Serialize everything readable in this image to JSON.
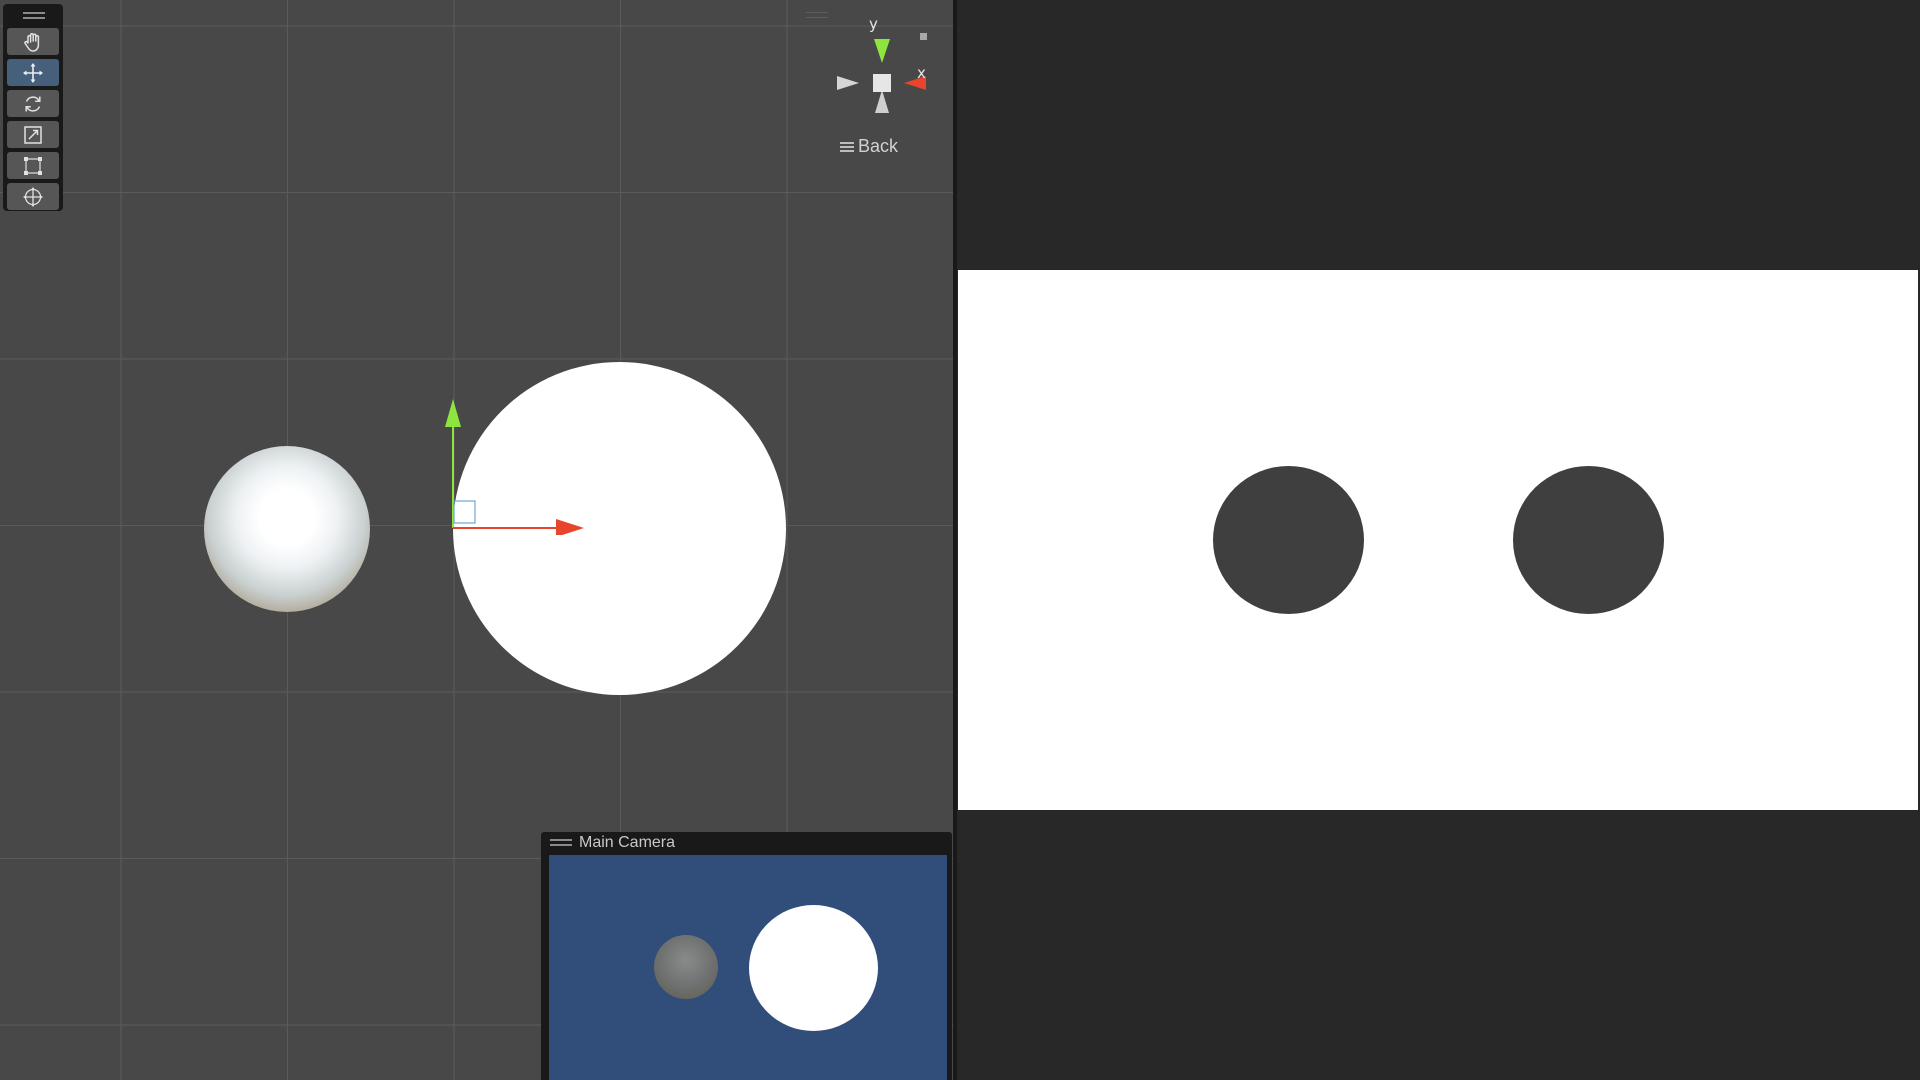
{
  "scene_view": {
    "toolbar": {
      "tools": [
        {
          "name": "hand-tool",
          "icon": "hand-icon",
          "active": false
        },
        {
          "name": "move-tool",
          "icon": "move-arrows-icon",
          "active": true
        },
        {
          "name": "rotate-tool",
          "icon": "rotate-icon",
          "active": false
        },
        {
          "name": "scale-tool",
          "icon": "scale-icon",
          "active": false
        },
        {
          "name": "rect-tool",
          "icon": "rect-transform-icon",
          "active": false
        },
        {
          "name": "transform-tool",
          "icon": "transform-icon",
          "active": false
        }
      ]
    },
    "gizmo": {
      "y_label": "y",
      "x_label": "x",
      "view_label": "Back",
      "colors": {
        "y_axis": "#8ee53f",
        "x_axis": "#e8452c",
        "neutral": "#d0d0d0"
      }
    },
    "camera_preview": {
      "title": "Main Camera",
      "background_color": "#314d79"
    },
    "grid_color": "#5b5b5b",
    "background_color": "#484848"
  },
  "game_view": {
    "background_color": "#282828",
    "canvas_color": "#ffffff",
    "disc_color": "#3f3f3f"
  }
}
